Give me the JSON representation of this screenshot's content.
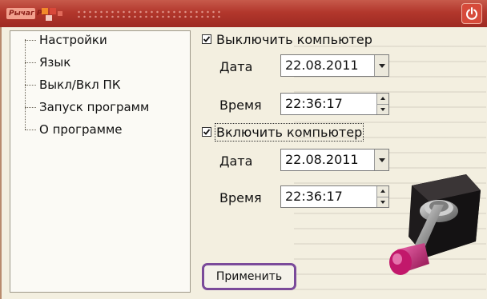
{
  "titlebar": {
    "logo_text": "Рычаг PC",
    "power_icon": "power-icon"
  },
  "tree": {
    "items": [
      {
        "label": "Настройки"
      },
      {
        "label": "Язык"
      },
      {
        "label": "Выкл/Вкл ПК"
      },
      {
        "label": "Запуск программ"
      },
      {
        "label": "О программе"
      }
    ]
  },
  "shutdown": {
    "checked": true,
    "label": "Выключить компьютер",
    "date_label": "Дата",
    "date_value": "22.08.2011",
    "time_label": "Время",
    "time_value": "22:36:17"
  },
  "startup": {
    "checked": true,
    "label": "Включить компьютер",
    "date_label": "Дата",
    "date_value": "22.08.2011",
    "time_label": "Время",
    "time_value": "22:36:17"
  },
  "apply_button": {
    "label": "Применить"
  },
  "colors": {
    "titlebar": "#b2372c",
    "apply_border": "#7a4a9a",
    "switch_handle": "#c2186b"
  }
}
